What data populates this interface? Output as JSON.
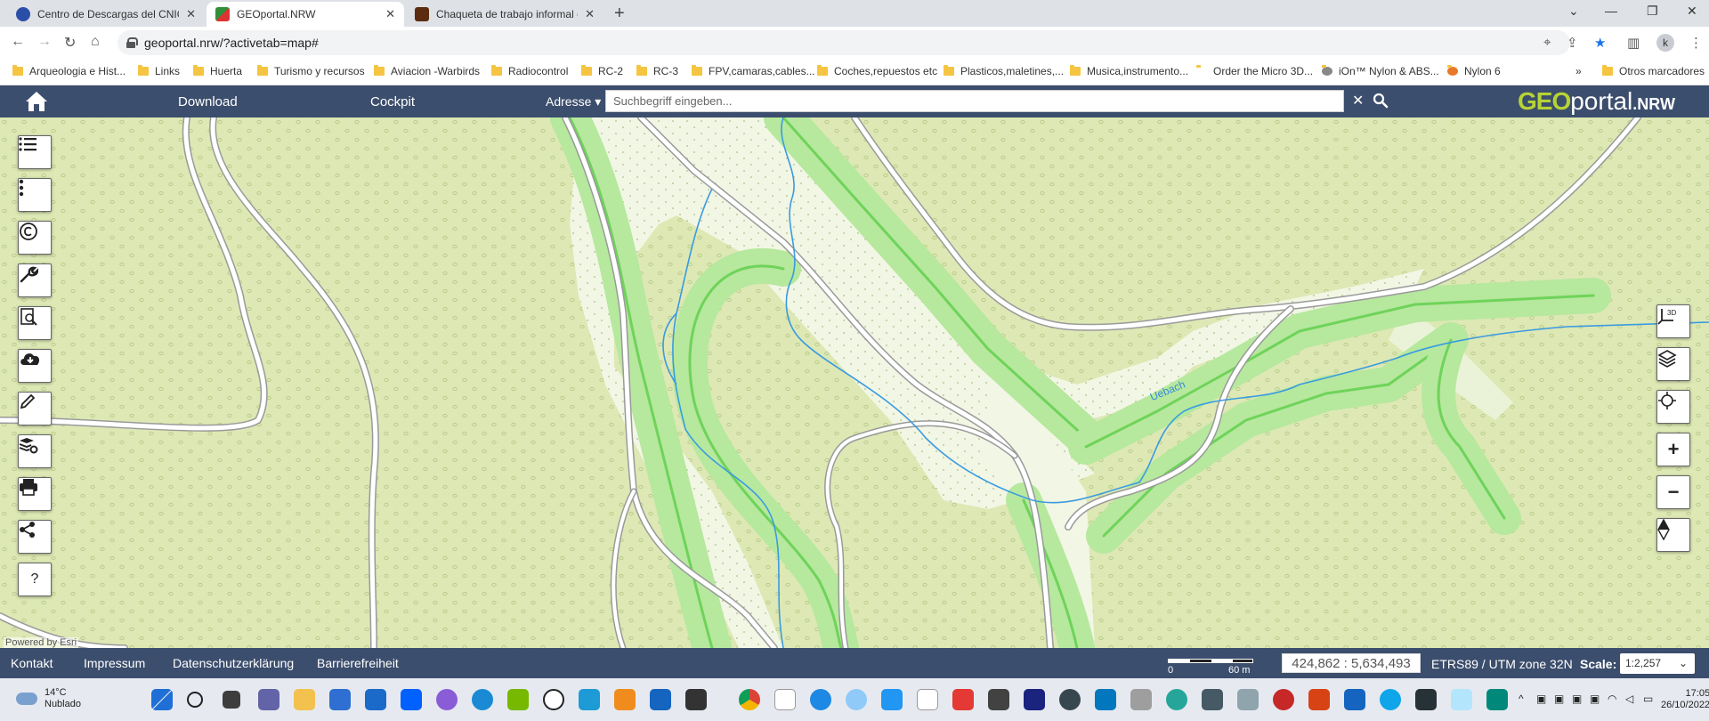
{
  "browser": {
    "tabs": [
      {
        "title": "Centro de Descargas del CNIG (IGN)",
        "active": false,
        "favicon_color": "#2b4fa8"
      },
      {
        "title": "GEOportal.NRW",
        "active": true,
        "favicon_color": "#2f8f3a"
      },
      {
        "title": "Chaqueta de trabajo informal cálida",
        "active": false,
        "favicon_color": "#5b2c10"
      }
    ],
    "new_tab": "+",
    "url": "geoportal.nrw/?activetab=map#",
    "profile_initial": "k",
    "bookmarks": [
      {
        "label": "Arqueologia e Hist..."
      },
      {
        "label": "Links"
      },
      {
        "label": "Huerta"
      },
      {
        "label": "Turismo y recursos"
      },
      {
        "label": "Aviacion -Warbirds"
      },
      {
        "label": "Radiocontrol"
      },
      {
        "label": "RC-2"
      },
      {
        "label": "RC-3"
      },
      {
        "label": "FPV,camaras,cables..."
      },
      {
        "label": "Coches,repuestos etc"
      },
      {
        "label": "Plasticos,maletines,..."
      },
      {
        "label": "Musica,instrumento..."
      },
      {
        "label": "Order the Micro 3D..."
      },
      {
        "label": "iOn™ Nylon & ABS..."
      },
      {
        "label": "Nylon 6"
      }
    ],
    "more_bookmarks": "»",
    "other_bookmarks": "Otros marcadores"
  },
  "app": {
    "nav": {
      "download": "Download",
      "cockpit": "Cockpit"
    },
    "search": {
      "scope": "Adresse ▾",
      "placeholder": "Suchbegriff eingeben..."
    },
    "logo": {
      "geo": "GEO",
      "portal": "portal",
      "nrw": ".NRW"
    },
    "left_tools": [
      "list-icon",
      "more-icon",
      "copyright-icon",
      "wrench-icon",
      "search-document-icon",
      "download-icon",
      "pencil-icon",
      "layers-settings-icon",
      "printer-icon",
      "share-icon",
      "help-icon"
    ],
    "help_label": "?",
    "right_tools": [
      "3d-view-icon",
      "layers-icon",
      "locate-icon",
      "zoom-in-icon",
      "zoom-out-icon",
      "compass-icon"
    ],
    "right_tool_labels": {
      "zoom_in": "+",
      "zoom_out": "−"
    },
    "map": {
      "attribution": "Powered by Esri",
      "creek_name": "Uebach"
    },
    "footer": {
      "links": [
        "Kontakt",
        "Impressum",
        "Datenschutzerklärung",
        "Barrierefreiheit"
      ],
      "scale_bar": {
        "start": "0",
        "end": "60 m"
      },
      "coordinates": "424,862 : 5,634,493",
      "crs": "ETRS89 / UTM zone 32N",
      "scale_label": "Scale:",
      "scale_value": "1:2,257",
      "scale_chevron": "⌄"
    }
  },
  "taskbar": {
    "weather": {
      "temp": "14°C",
      "condition": "Nublado"
    },
    "clock": {
      "time": "17:05",
      "date": "26/10/2022"
    }
  },
  "colors": {
    "header_bg": "#3c4e6d",
    "map_bg": "#dde8b4",
    "green_band": "#6fd35a",
    "road": "#ffffff",
    "water": "#3a9be0",
    "logo_geo": "#b6d334"
  }
}
